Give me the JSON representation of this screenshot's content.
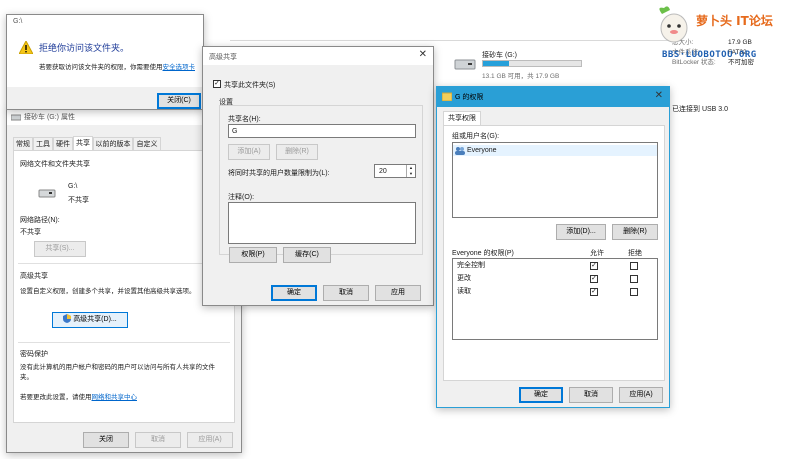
{
  "background": {
    "drive_name": "接砂车 (G:)",
    "drive_space": "13.1 GB 可用，共 17.9 GB",
    "drive_progress": 0.27,
    "details_rows": [
      {
        "label": "总大小:",
        "value": "17.9 GB"
      },
      {
        "label": "文件系统:",
        "value": "FAT32"
      },
      {
        "label": "BitLocker 状态:",
        "value": "不可加密"
      }
    ],
    "connected": "已连接到 USB 3.0",
    "logo_text": "萝卜头 IT论坛",
    "logo_url": "BBS·LUOBOTOU·ORG"
  },
  "access_dialog": {
    "title": "G:\\",
    "heading": "拒绝你访问该文件夹。",
    "body_prefix": "若要获取访问该文件夹的权限，你需要使用",
    "body_link": "安全选项卡",
    "close_label": "关闭(C)"
  },
  "props": {
    "title": "接砂车 (G:) 属性",
    "tabs": [
      "常规",
      "工具",
      "硬件",
      "共享",
      "以前的版本",
      "自定义"
    ],
    "net_share_title": "网络文件和文件夹共享",
    "drive_path": "G:\\",
    "share_state": "不共享",
    "net_path_label": "网络路径(N):",
    "net_path_value": "不共享",
    "share_button": "共享(S)...",
    "adv_title": "高级共享",
    "adv_desc": "设置自定义权限，创建多个共享，并设置其他高级共享选项。",
    "adv_button": "高级共享(D)...",
    "pwd_title": "密码保护",
    "pwd_desc": "没有此计算机的用户帐户和密码的用户可以访问与所有人共享的文件夹。",
    "pwd_change_prefix": "若要更改此设置，请使用",
    "pwd_link": "网络和共享中心",
    "btn_close": "关闭",
    "btn_cancel": "取消",
    "btn_apply": "应用(A)"
  },
  "adv": {
    "title": "高级共享",
    "share_checkbox": "共享此文件夹(S)",
    "settings_label": "设置",
    "share_name_label": "共享名(H):",
    "share_name_value": "G",
    "add_button": "添加(A)",
    "remove_button": "删除(R)",
    "limit_label": "将同时共享的用户数量限制为(L):",
    "limit_value": "20",
    "comment_label": "注释(O):",
    "perm_button": "权限(P)",
    "cache_button": "缓存(C)",
    "ok": "确定",
    "cancel": "取消",
    "apply": "应用"
  },
  "perm": {
    "title": "G 的权限",
    "tab": "共享权限",
    "group_label": "组或用户名(G):",
    "users": [
      "Everyone"
    ],
    "add_button": "添加(D)...",
    "remove_button": "删除(R)",
    "perm_header": "Everyone 的权限(P)",
    "allow": "允许",
    "deny": "拒绝",
    "rows": [
      {
        "name": "完全控制",
        "allow": "✓",
        "deny": ""
      },
      {
        "name": "更改",
        "allow": "✓",
        "deny": ""
      },
      {
        "name": "读取",
        "allow": "✓",
        "deny": ""
      }
    ],
    "ok": "确定",
    "cancel": "取消",
    "apply": "应用(A)",
    "accent": "#2a9fd6"
  }
}
